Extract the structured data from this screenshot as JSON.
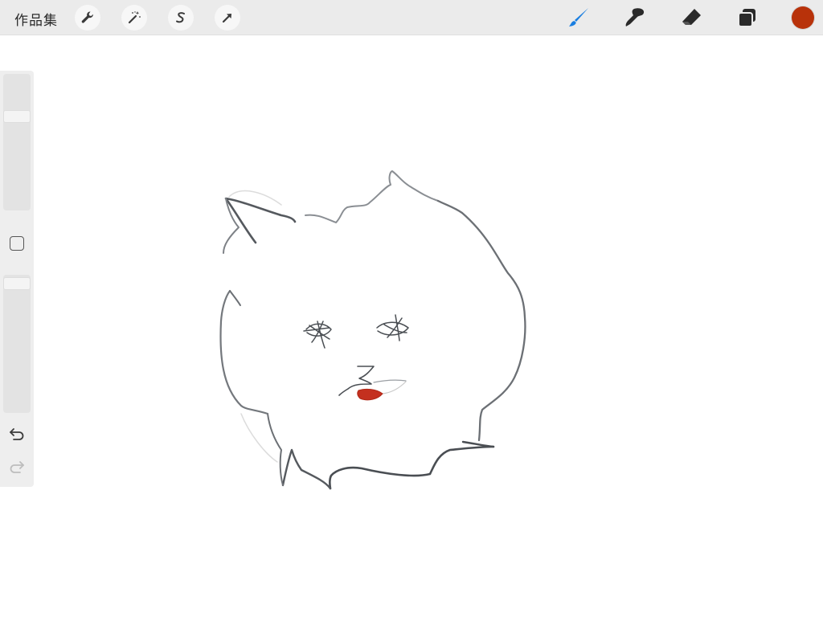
{
  "app": {
    "gallery_label": "作品集"
  },
  "toolbar": {
    "left_tools": [
      "wrench-icon",
      "magic-wand-icon",
      "selection-s-icon",
      "transform-arrow-icon"
    ],
    "right_tools": [
      "brush-icon",
      "smudge-icon",
      "eraser-icon",
      "layers-icon"
    ],
    "active_tool": "brush-icon",
    "active_color": "#1a7ee0",
    "current_color": "#b8320a"
  },
  "sidebar": {
    "controls": [
      "brush-size-slider",
      "modify-button",
      "opacity-slider",
      "undo-icon",
      "redo-icon"
    ]
  }
}
